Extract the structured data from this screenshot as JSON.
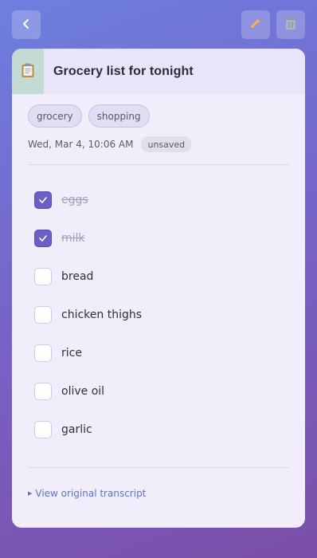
{
  "topbar": {
    "back_icon": "chevron-left-icon",
    "edit_icon": "pencil-icon",
    "delete_icon": "trash-icon"
  },
  "note": {
    "icon": "clipboard-icon",
    "title": "Grocery list for tonight",
    "tags": [
      "grocery",
      "shopping"
    ],
    "timestamp": "Wed, Mar 4, 10:06 AM",
    "status": "unsaved",
    "items": [
      {
        "label": "eggs",
        "checked": true
      },
      {
        "label": "milk",
        "checked": true
      },
      {
        "label": "bread",
        "checked": false
      },
      {
        "label": "chicken thighs",
        "checked": false
      },
      {
        "label": "rice",
        "checked": false
      },
      {
        "label": "olive oil",
        "checked": false
      },
      {
        "label": "garlic",
        "checked": false
      }
    ],
    "transcript_link": "View original transcript"
  },
  "colors": {
    "accent": "#6c5fc7",
    "link": "#6470c9"
  }
}
